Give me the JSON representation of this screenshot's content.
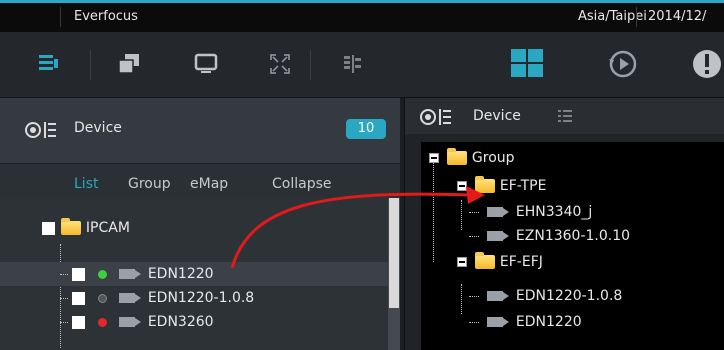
{
  "titlebar": {
    "app_name": "Everfocus",
    "timezone": "Asia/Taipei",
    "date": "2014/12/"
  },
  "toolbar": {
    "icons": [
      "device-list-icon",
      "windows-icon",
      "monitor-icon",
      "fullscreen-icon",
      "layout-icon",
      "grid-view-icon",
      "playback-icon",
      "alert-icon"
    ]
  },
  "left_panel": {
    "title": "Device",
    "count": "10",
    "tabs": {
      "list": "List",
      "group": "Group",
      "emap": "eMap",
      "collapse": "Collapse"
    },
    "root": "IPCAM",
    "devices": [
      {
        "name": "EDN1220",
        "status_color": "#3bd13b"
      },
      {
        "name": "EDN1220-1.0.8",
        "status_color": "#555555"
      },
      {
        "name": "EDN3260",
        "status_color": "#e02a2a"
      }
    ]
  },
  "right_panel": {
    "title": "Device",
    "root": "Group",
    "groups": [
      {
        "name": "EF-TPE",
        "devices": [
          "EHN3340_j",
          "EZN1360-1.0.10"
        ]
      },
      {
        "name": "EF-EFJ",
        "devices": [
          "EDN1220-1.0.8",
          "EDN1220"
        ]
      }
    ]
  },
  "accent_color": "#2aa7c3"
}
